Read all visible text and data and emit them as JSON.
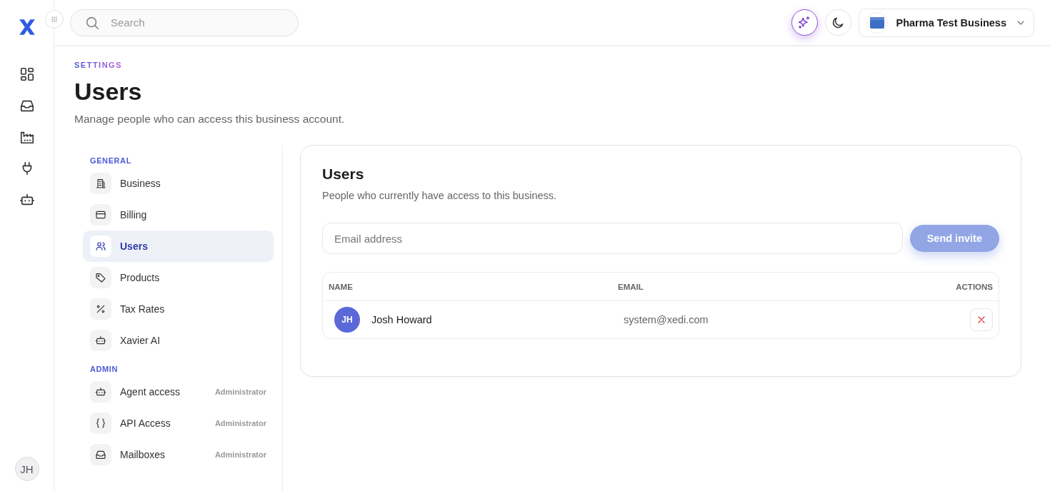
{
  "topbar": {
    "search": {
      "placeholder": "Search"
    },
    "business": {
      "name": "Pharma Test Business"
    }
  },
  "rail": {
    "items": [
      {
        "kind": "grid",
        "selected": false
      },
      {
        "kind": "inbox",
        "selected": false
      },
      {
        "kind": "factory",
        "selected": false
      },
      {
        "kind": "plug",
        "selected": false
      },
      {
        "kind": "bot",
        "selected": false
      }
    ],
    "avatar": "JH"
  },
  "header": {
    "eyebrow": "SETTINGS",
    "title": "Users",
    "subtitle": "Manage people who can access this business account."
  },
  "settings_nav": [
    {
      "heading": "GENERAL",
      "items": [
        {
          "label": "Business",
          "kind": "building",
          "selected": false
        },
        {
          "label": "Billing",
          "kind": "card",
          "selected": false
        },
        {
          "label": "Users",
          "kind": "users",
          "selected": true
        },
        {
          "label": "Products",
          "kind": "tag",
          "selected": false
        },
        {
          "label": "Tax Rates",
          "kind": "percent",
          "selected": false
        },
        {
          "label": "Xavier AI",
          "kind": "bot",
          "selected": false
        }
      ]
    },
    {
      "heading": "ADMIN",
      "items": [
        {
          "label": "Agent access",
          "kind": "bot",
          "selected": false,
          "role": "Administrator"
        },
        {
          "label": "API Access",
          "kind": "braces",
          "selected": false,
          "role": "Administrator"
        },
        {
          "label": "Mailboxes",
          "kind": "inbox",
          "selected": false,
          "role": "Administrator"
        }
      ]
    }
  ],
  "card": {
    "title": "Users",
    "subtitle": "People who currently have access to this business.",
    "email": {
      "placeholder": "Email address"
    },
    "invite_button": {
      "label": "Send invite",
      "disabled": true
    },
    "table": {
      "columns": [
        "NAME",
        "EMAIL",
        "ACTIONS"
      ],
      "rows": [
        {
          "initials": "JH",
          "name": "Josh Howard",
          "email": "system@xedi.com"
        }
      ]
    }
  }
}
